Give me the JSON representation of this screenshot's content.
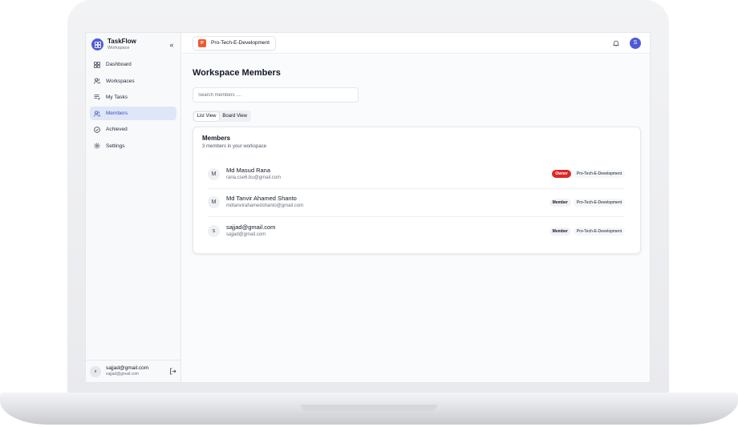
{
  "app": {
    "name": "TaskFlow",
    "subtitle": "Workspace",
    "collapse_glyph": "«"
  },
  "sidebar": {
    "items": [
      {
        "label": "Dashboard",
        "icon": "dashboard-icon"
      },
      {
        "label": "Workspaces",
        "icon": "users-icon"
      },
      {
        "label": "My Tasks",
        "icon": "list-icon"
      },
      {
        "label": "Members",
        "icon": "members-icon",
        "active": true
      },
      {
        "label": "Achieved",
        "icon": "check-circle-icon"
      },
      {
        "label": "Settings",
        "icon": "gear-icon"
      }
    ],
    "footer": {
      "avatar_initial": "s",
      "name": "sajjad@gmail.com",
      "email": "sajjad@gmail.com"
    }
  },
  "topbar": {
    "workspace_initial": "P",
    "workspace_name": "Pro-Tech-E-Development",
    "user_initial": "S"
  },
  "page": {
    "title": "Workspace Members",
    "search_placeholder": "Search members ....",
    "views": [
      "List View",
      "Board View"
    ],
    "active_view": "List View"
  },
  "members_card": {
    "title": "Members",
    "subtitle": "3 members in your workspace",
    "members": [
      {
        "initial": "M",
        "name": "Md Masud Rana",
        "email": "rana.cse6.bu@gmail.com",
        "role": "Owner",
        "workspace": "Pro-Tech-E-Development"
      },
      {
        "initial": "M",
        "name": "Md Tanvir Ahamed Shanto",
        "email": "mdtanvirahamedshanto@gmail.com",
        "role": "Member",
        "workspace": "Pro-Tech-E-Development"
      },
      {
        "initial": "s",
        "name": "sajjad@gmail.com",
        "email": "sajjad@gmail.com",
        "role": "Member",
        "workspace": "Pro-Tech-E-Development"
      }
    ]
  },
  "colors": {
    "accent": "#4f5bd5",
    "active_nav_bg": "#dfe6f7",
    "owner_badge": "#dc2626",
    "workspace_badge": "#ef5a2f"
  }
}
